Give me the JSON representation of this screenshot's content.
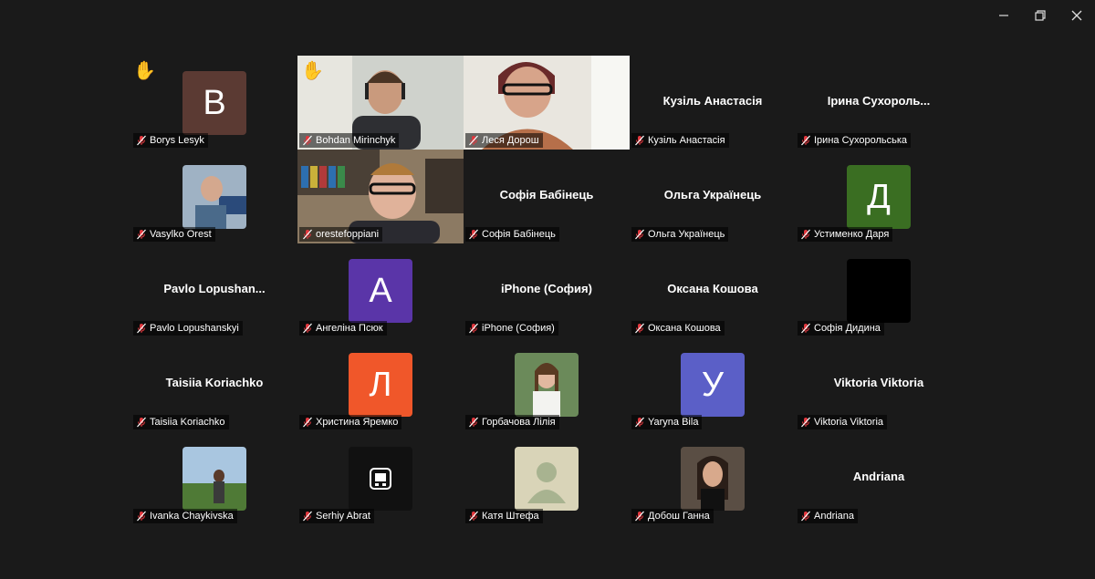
{
  "window_controls": {
    "minimize": "—",
    "restore": "❐",
    "close": "✕"
  },
  "colors": {
    "active_speaker": "#27c46a",
    "muted_mic": "#e0383e"
  },
  "participants": [
    {
      "name": "Borys Lesyk",
      "kind": "avatar",
      "letter": "B",
      "avatar_color": "#5b3a33",
      "hand_raised": true
    },
    {
      "name": "Bohdan Mirinchyk",
      "kind": "video",
      "hand_raised": true
    },
    {
      "name": "Леся Дорош",
      "kind": "video"
    },
    {
      "name": "Кузіль Анастасія",
      "kind": "name",
      "display": "Кузіль Анастасія"
    },
    {
      "name": "Ірина Сухорольська",
      "kind": "name",
      "display": "Ірина  Сухороль..."
    },
    {
      "name": "Vasylko Orest",
      "kind": "photo"
    },
    {
      "name": "orestefoppiani",
      "kind": "video",
      "active": true
    },
    {
      "name": "Софія Бабінець",
      "kind": "name",
      "display": "Софія Бабінець"
    },
    {
      "name": "Ольга Українець",
      "kind": "name",
      "display": "Ольга Українець"
    },
    {
      "name": "Устименко Даря",
      "kind": "avatar",
      "letter": "Д",
      "avatar_color": "#3a6e22"
    },
    {
      "name": "Pavlo Lopushanskyi",
      "kind": "name",
      "display": "Pavlo  Lopushan..."
    },
    {
      "name": "Ангеліна Псюк",
      "kind": "avatar",
      "letter": "A",
      "avatar_color": "#5a35a8"
    },
    {
      "name": "iPhone (София)",
      "kind": "name",
      "display": "iPhone (София)"
    },
    {
      "name": "Оксана Кошова",
      "kind": "name",
      "display": "Оксана Кошова"
    },
    {
      "name": "Софія Дидина",
      "kind": "avatar",
      "letter": "",
      "avatar_color": "#000000"
    },
    {
      "name": "Taisiia Koriachko",
      "kind": "name",
      "display": "Taisiia Koriachko"
    },
    {
      "name": "Христина Яремко",
      "kind": "avatar",
      "letter": "Л",
      "avatar_color": "#f0572a"
    },
    {
      "name": "Горбачова Лілія",
      "kind": "photo"
    },
    {
      "name": "Yaryna Bila",
      "kind": "avatar",
      "letter": "У",
      "avatar_color": "#5b5fc7"
    },
    {
      "name": "Viktoria Viktoria",
      "kind": "name",
      "display": "Viktoria Viktoria"
    },
    {
      "name": "Ivanka Chaykivska",
      "kind": "photo"
    },
    {
      "name": "Serhiy Abrat",
      "kind": "photo"
    },
    {
      "name": "Катя Штефа",
      "kind": "photo"
    },
    {
      "name": "Добош Ганна",
      "kind": "photo"
    },
    {
      "name": "Andriana",
      "kind": "name",
      "display": "Andriana"
    }
  ]
}
